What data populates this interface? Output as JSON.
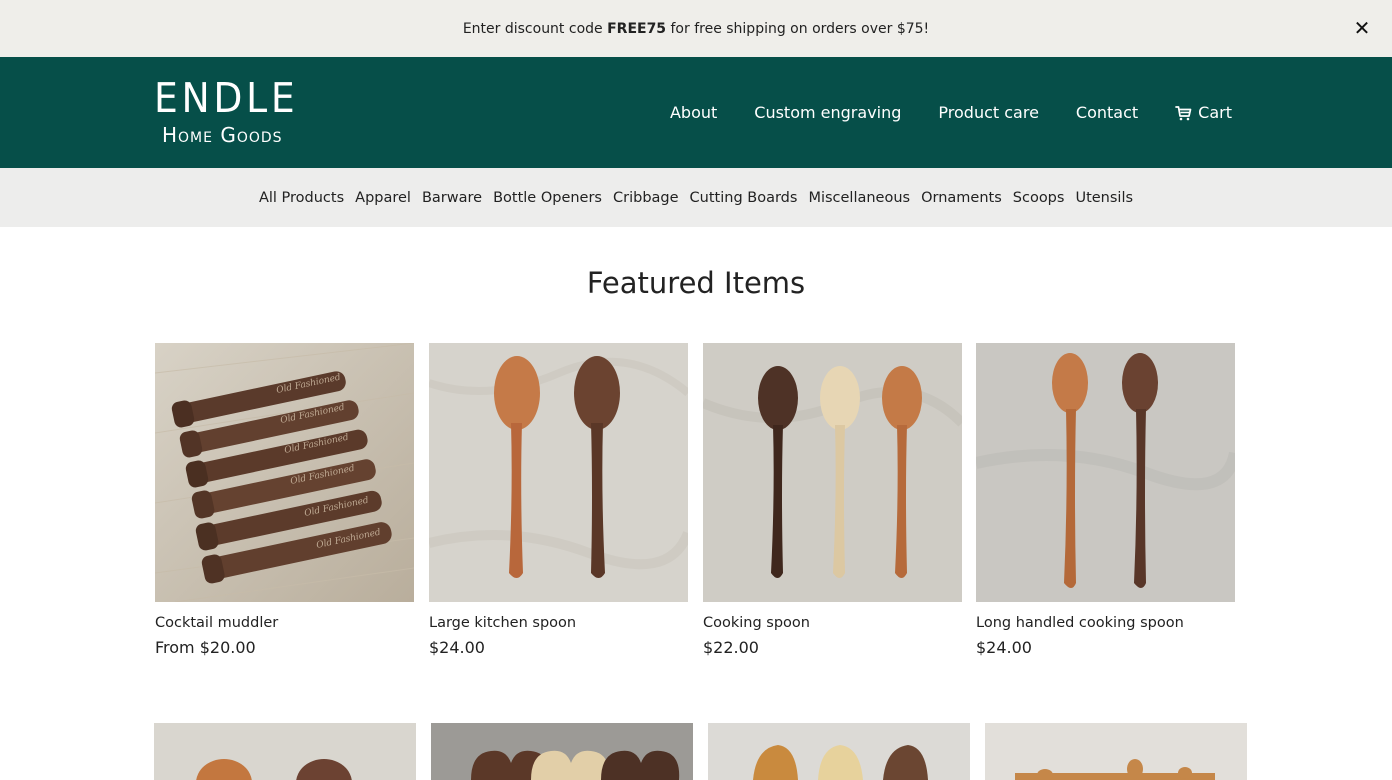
{
  "announcement": {
    "prefix": "Enter discount code ",
    "code": "FREE75",
    "suffix": " for free shipping on orders over $75!",
    "close_icon": "close-icon"
  },
  "brand": {
    "name": "ENDLE",
    "subtitle": "Home Goods",
    "bg_color": "#064f49"
  },
  "nav": {
    "items": [
      {
        "label": "About"
      },
      {
        "label": "Custom engraving"
      },
      {
        "label": "Product care"
      },
      {
        "label": "Contact"
      }
    ],
    "cart_label": "Cart",
    "cart_icon": "cart-icon"
  },
  "categories": [
    "All Products",
    "Apparel",
    "Barware",
    "Bottle Openers",
    "Cribbage",
    "Cutting Boards",
    "Miscellaneous",
    "Ornaments",
    "Scoops",
    "Utensils"
  ],
  "featured": {
    "title": "Featured Items",
    "products": [
      {
        "name": "Cocktail muddler",
        "price": "From $20.00",
        "engraving": "Old Fashioned"
      },
      {
        "name": "Large kitchen spoon",
        "price": "$24.00"
      },
      {
        "name": "Cooking spoon",
        "price": "$22.00"
      },
      {
        "name": "Long handled cooking spoon",
        "price": "$24.00"
      }
    ]
  }
}
